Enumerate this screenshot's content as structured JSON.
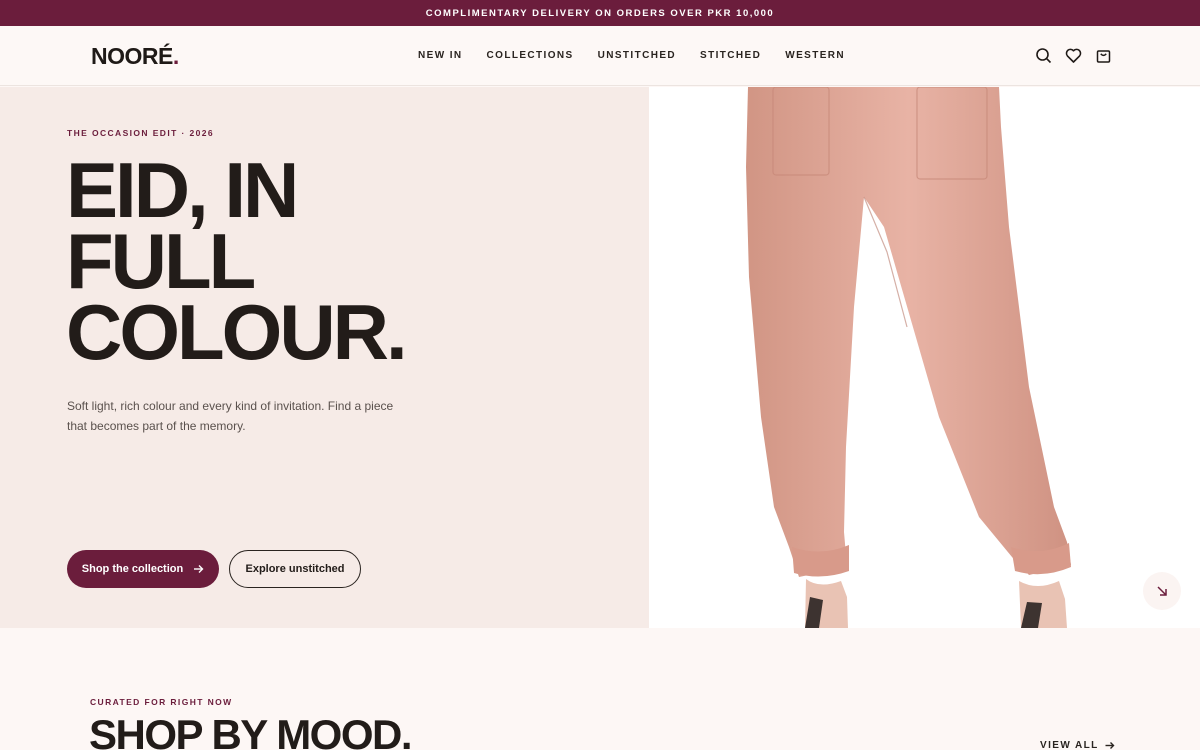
{
  "announcement": "COMPLIMENTARY DELIVERY ON ORDERS OVER PKR 10,000",
  "brand": {
    "name": "NOORÉ",
    "dot": ".",
    "accent": "#6b1d3c"
  },
  "nav": [
    "NEW IN",
    "COLLECTIONS",
    "UNSTITCHED",
    "STITCHED",
    "WESTERN"
  ],
  "header_icons": [
    "search-icon",
    "heart-icon",
    "shopping-bag-icon"
  ],
  "hero": {
    "eyebrow": "THE OCCASION EDIT · 2026",
    "headline": [
      "EID, IN",
      "FULL",
      "COLOUR."
    ],
    "subcopy": "Soft light, rich colour and every kind of invitation. Find a piece that becomes part of the memory.",
    "primary_cta": "Shop the collection",
    "secondary_cta": "Explore unstitched",
    "image_icon": "arrow-down-right-icon"
  },
  "mood": {
    "eyebrow": "CURATED FOR RIGHT NOW",
    "title": "SHOP BY MOOD.",
    "view_all": "VIEW ALL"
  }
}
